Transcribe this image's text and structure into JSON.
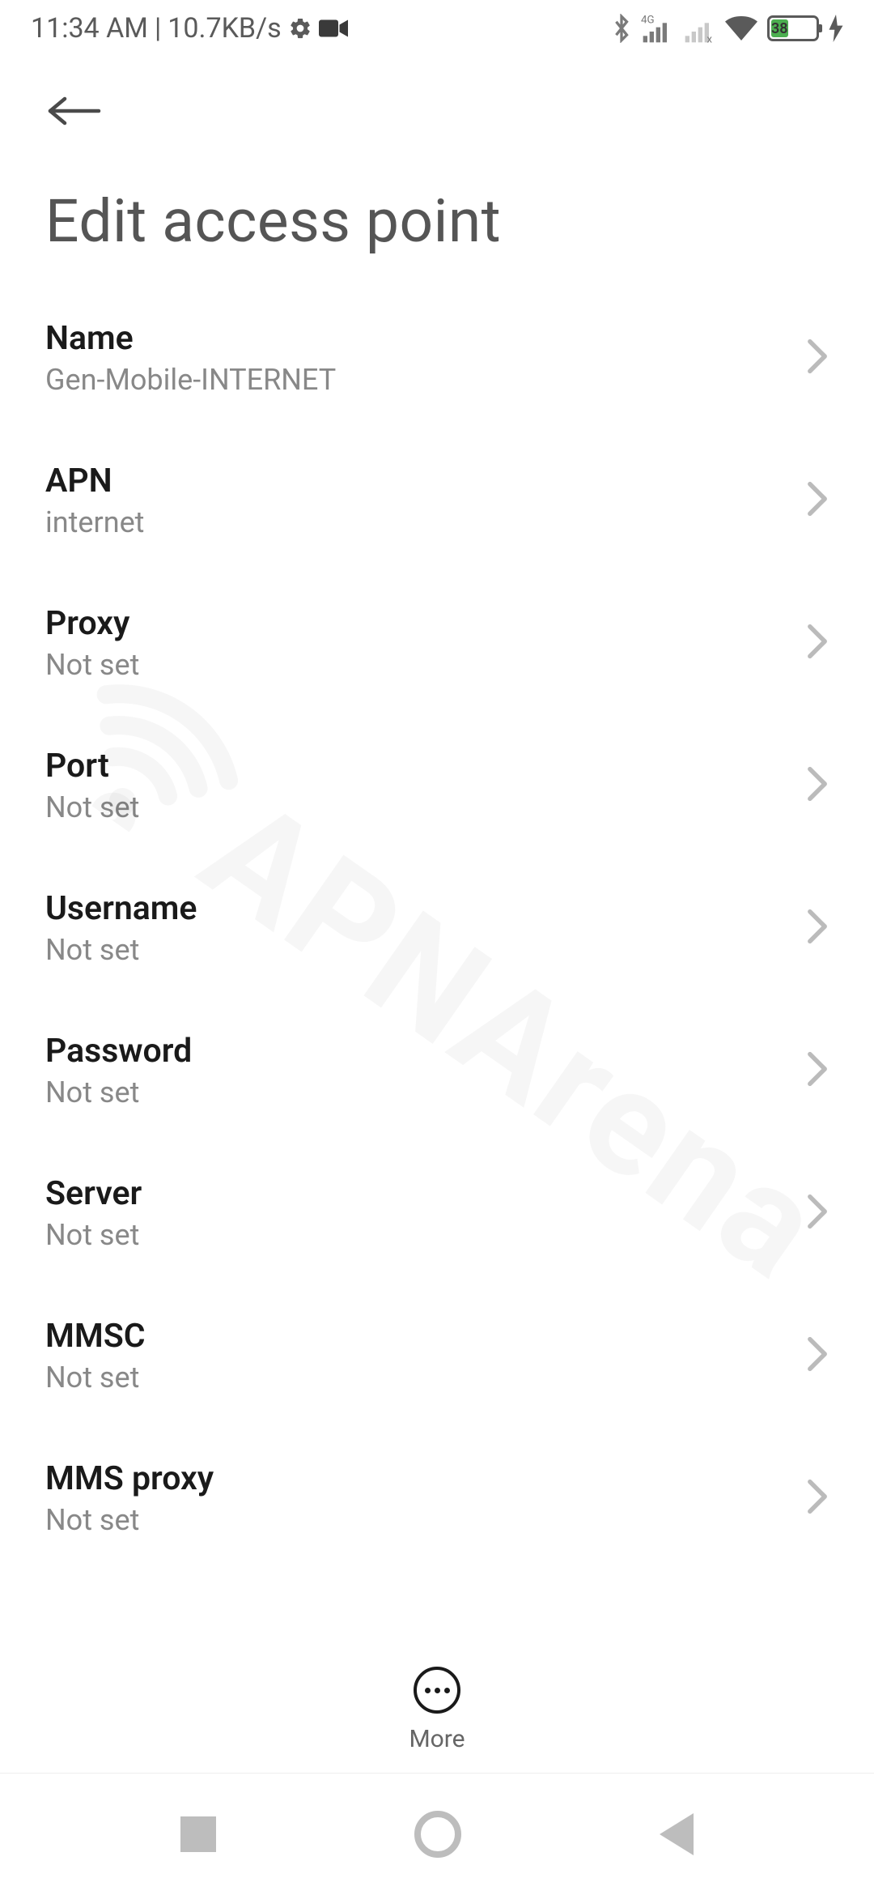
{
  "status_bar": {
    "time": "11:34 AM",
    "speed": "10.7KB/s",
    "battery_pct": 38
  },
  "header": {
    "title": "Edit access point"
  },
  "settings": [
    {
      "key": "name",
      "label": "Name",
      "value": "Gen-Mobile-INTERNET"
    },
    {
      "key": "apn",
      "label": "APN",
      "value": "internet"
    },
    {
      "key": "proxy",
      "label": "Proxy",
      "value": "Not set"
    },
    {
      "key": "port",
      "label": "Port",
      "value": "Not set"
    },
    {
      "key": "username",
      "label": "Username",
      "value": "Not set"
    },
    {
      "key": "password",
      "label": "Password",
      "value": "Not set"
    },
    {
      "key": "server",
      "label": "Server",
      "value": "Not set"
    },
    {
      "key": "mmsc",
      "label": "MMSC",
      "value": "Not set"
    },
    {
      "key": "mms_proxy",
      "label": "MMS proxy",
      "value": "Not set"
    }
  ],
  "bottom_action": {
    "label": "More"
  },
  "watermark": "APNArena"
}
